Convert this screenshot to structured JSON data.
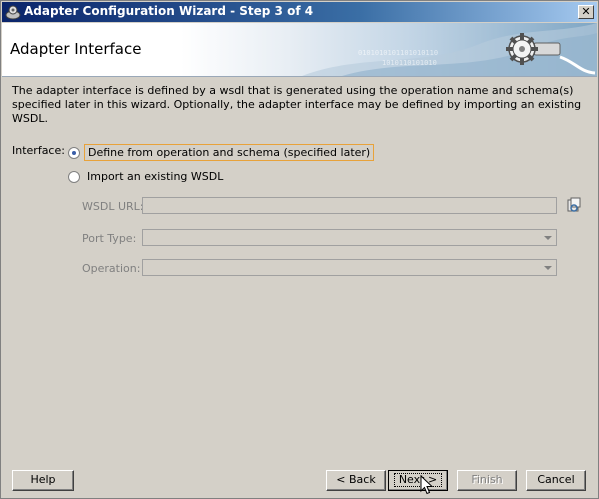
{
  "window": {
    "title": "Adapter Configuration Wizard - Step 3 of 4",
    "close_label": "✕",
    "title_icon": "adapter-wizard-icon"
  },
  "banner": {
    "title": "Adapter Interface",
    "icon": "gear-plug-icon"
  },
  "description": "The adapter interface is defined by a wsdl that is generated using the operation name and schema(s) specified later in this wizard.  Optionally, the adapter interface may be defined by importing an existing WSDL.",
  "interface": {
    "label": "Interface:",
    "options": [
      {
        "label": "Define from operation and schema (specified later)",
        "selected": true
      },
      {
        "label": "Import an existing WSDL",
        "selected": false
      }
    ]
  },
  "fields": {
    "wsdl_url": {
      "label": "WSDL URL:",
      "value": ""
    },
    "port_type": {
      "label": "Port Type:",
      "value": ""
    },
    "operation": {
      "label": "Operation:",
      "value": ""
    }
  },
  "buttons": {
    "help": "Help",
    "back": "< Back",
    "next": "Next >",
    "finish": "Finish",
    "cancel": "Cancel"
  },
  "colors": {
    "title_bar": "#0a246a",
    "dialog_bg": "#d4d0c8",
    "focus_border": "#e8a23a"
  }
}
